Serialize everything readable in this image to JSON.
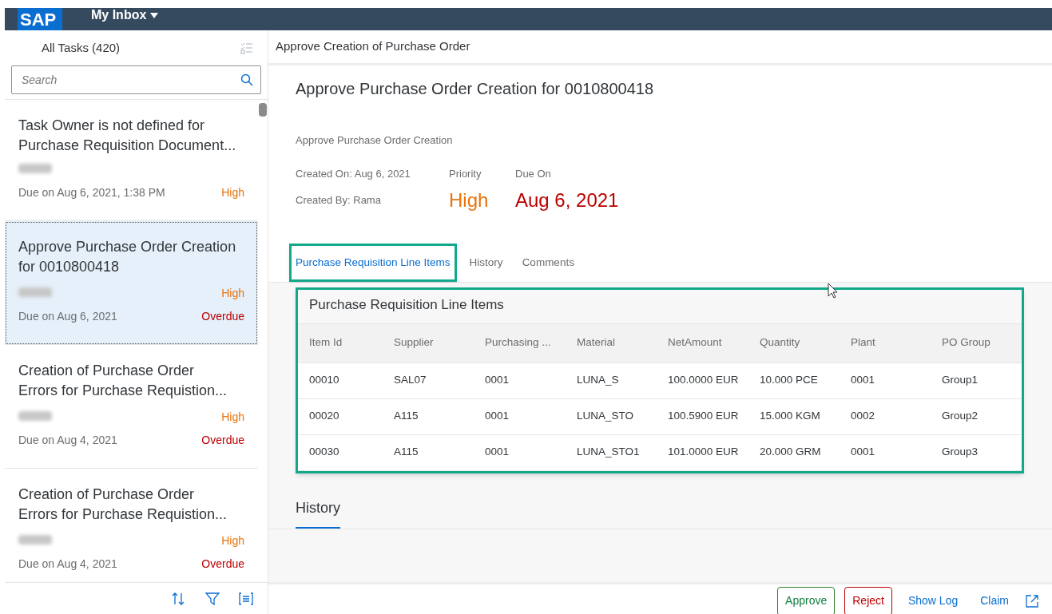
{
  "shell": {
    "logo": "SAP",
    "app_title": "My Inbox"
  },
  "task_list": {
    "title": "All Tasks (420)",
    "search": {
      "placeholder": "Search"
    },
    "items": [
      {
        "title": "Task Owner is not defined for Purchase Requisition Document...",
        "priority": "High",
        "due": "Due on Aug 6, 2021, 1:38 PM",
        "selected": false
      },
      {
        "title": "Approve Purchase Order Creation for 0010800418",
        "priority": "High",
        "status": "Overdue",
        "due": "Due on Aug 6, 2021",
        "selected": true
      },
      {
        "title": "Creation of Purchase Order Errors for Purchase Requistion...",
        "priority": "High",
        "status": "Overdue",
        "due": "Due on Aug 4, 2021",
        "selected": false
      },
      {
        "title": "Creation of Purchase Order Errors for Purchase Requistion...",
        "priority": "High",
        "status": "Overdue",
        "due": "Due on Aug 4, 2021",
        "selected": false
      }
    ]
  },
  "detail": {
    "header": "Approve Creation of Purchase Order",
    "title": "Approve Purchase Order Creation for 0010800418",
    "subtitle": "Approve Purchase Order Creation",
    "created_on": "Created On: Aug 6, 2021",
    "created_by": "Created By: Rama",
    "priority_label": "Priority",
    "priority": "High",
    "due_label": "Due On",
    "due": "Aug 6, 2021",
    "tabs": [
      {
        "label": "Purchase Requisition Line Items",
        "selected": true,
        "highlighted": true
      },
      {
        "label": "History",
        "selected": false,
        "highlighted": false
      },
      {
        "label": "Comments",
        "selected": false,
        "highlighted": false
      }
    ],
    "table": {
      "title": "Purchase Requisition Line Items",
      "highlighted": true,
      "columns": [
        "Item Id",
        "Supplier",
        "Purchasing ...",
        "Material",
        "NetAmount",
        "Quantity",
        "Plant",
        "PO Group"
      ],
      "rows": [
        [
          "00010",
          "SAL07",
          "0001",
          "LUNA_S",
          "100.0000 EUR",
          "10.000 PCE",
          "0001",
          "Group1"
        ],
        [
          "00020",
          "A115",
          "0001",
          "LUNA_STO",
          "100.5900 EUR",
          "15.000 KGM",
          "0002",
          "Group2"
        ],
        [
          "00030",
          "A115",
          "0001",
          "LUNA_STO1",
          "101.0000 EUR",
          "20.000 GRM",
          "0001",
          "Group3"
        ]
      ]
    },
    "history_title": "History"
  },
  "footer": {
    "buttons": [
      {
        "label": "Approve",
        "kind": "accept"
      },
      {
        "label": "Reject",
        "kind": "reject"
      },
      {
        "label": "Show Log",
        "kind": "plain"
      },
      {
        "label": "Claim",
        "kind": "plain"
      }
    ]
  }
}
